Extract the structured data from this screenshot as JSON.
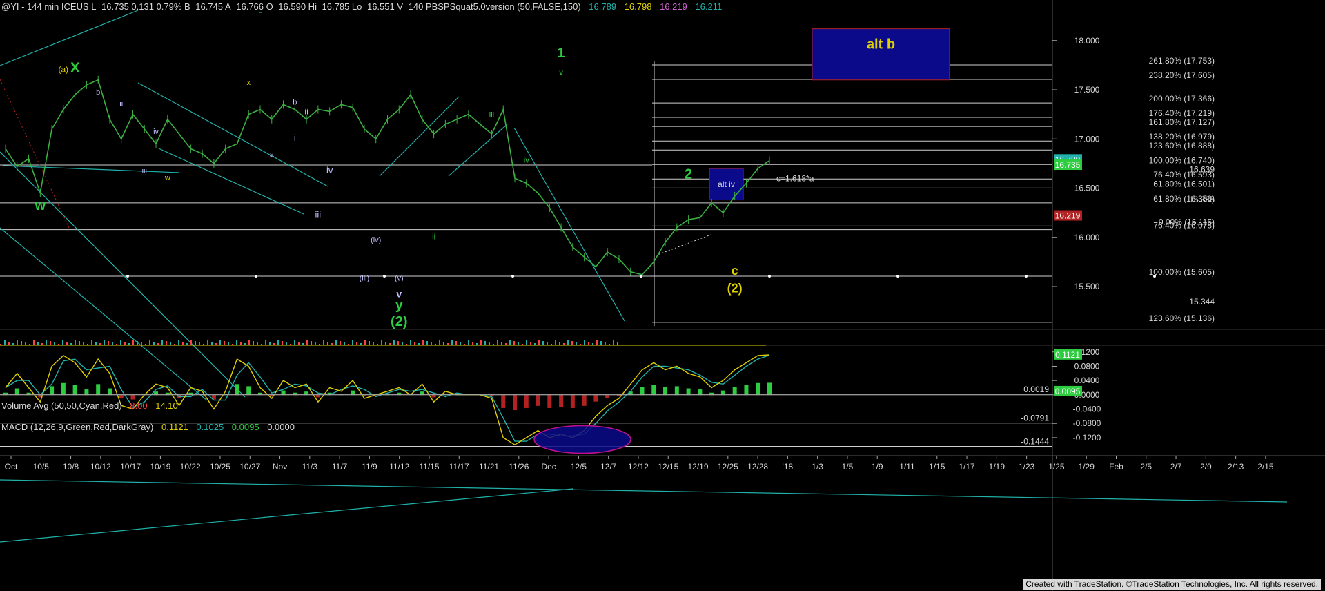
{
  "header": {
    "symbol_line": "@YI - 144 min  ICEUS  L=16.735  0.131  0.79%  B=16.745  A=16.766  O=16.590  Hi=16.785  Lo=16.551  V=140  PBSPSquat5.0version (50,FALSE,150)",
    "ind1": "16.789",
    "ind2": "16.798",
    "ind3": "16.219",
    "ind4": "16.211",
    "volume_label": "Volume Avg (50,50,Cyan,Red)",
    "volume_v1": "8.00",
    "volume_v2": "14.10",
    "macd_label": "MACD (12,26,9,Green,Red,DarkGray)",
    "macd_v1": "0.1121",
    "macd_v2": "0.1025",
    "macd_v3": "0.0095",
    "macd_v4": "0.0000"
  },
  "footer": "Created with TradeStation. ©TradeStation Technologies, Inc. All rights reserved.",
  "colors": {
    "bg": "#000000",
    "price": "#3cb043",
    "cyan": "#20b2aa",
    "white": "#d8d8d8",
    "yellow": "#e0d000",
    "green": "#2ecc40",
    "blue_box": "#0a0a8a",
    "red": "#b22222"
  },
  "chart_data": {
    "type": "line",
    "title": "@YI - 144 min",
    "price_axis": {
      "ticks": [
        "18.000",
        "17.500",
        "17.000",
        "16.500",
        "16.000",
        "15.500"
      ],
      "ylim": [
        15.1,
        18.3
      ]
    },
    "macd_axis": {
      "ticks": [
        "0.1200",
        "0.0800",
        "0.0400",
        "0.0000",
        "-0.0400",
        "-0.0800",
        "-0.1200"
      ],
      "ylim": [
        -0.155,
        0.135
      ]
    },
    "x_labels": [
      "Oct",
      "10/5",
      "10/8",
      "10/12",
      "10/17",
      "10/19",
      "10/22",
      "10/25",
      "10/27",
      "Nov",
      "11/3",
      "11/7",
      "11/9",
      "11/12",
      "11/15",
      "11/17",
      "11/21",
      "11/26",
      "Dec",
      "12/5",
      "12/7",
      "12/12",
      "12/15",
      "12/19",
      "12/25",
      "12/28",
      "'18",
      "1/3",
      "1/5",
      "1/9",
      "1/11",
      "1/15",
      "1/17",
      "1/19",
      "1/23",
      "1/25",
      "1/29",
      "Feb",
      "2/5",
      "2/7",
      "2/9",
      "2/13",
      "2/15"
    ],
    "price_series": [
      16.9,
      16.72,
      16.8,
      16.45,
      17.1,
      17.3,
      17.45,
      17.55,
      17.6,
      17.2,
      17.0,
      17.25,
      17.1,
      16.95,
      17.2,
      17.05,
      16.9,
      16.85,
      16.75,
      16.9,
      16.95,
      17.25,
      17.3,
      17.2,
      17.35,
      17.3,
      17.2,
      17.3,
      17.28,
      17.35,
      17.32,
      17.1,
      17.0,
      17.2,
      17.3,
      17.45,
      17.2,
      17.05,
      17.15,
      17.2,
      17.25,
      17.15,
      17.05,
      17.3,
      16.6,
      16.55,
      16.45,
      16.3,
      16.1,
      15.9,
      15.8,
      15.7,
      15.85,
      15.78,
      15.65,
      15.62,
      15.75,
      15.95,
      16.1,
      16.18,
      16.2,
      16.35,
      16.25,
      16.42,
      16.55,
      16.7,
      16.78
    ],
    "macd_series": [
      0.02,
      0.06,
      0.02,
      -0.02,
      0.08,
      0.11,
      0.09,
      0.05,
      0.1,
      0.06,
      -0.03,
      -0.04,
      0.0,
      0.03,
      0.02,
      -0.03,
      0.02,
      0.01,
      -0.04,
      0.01,
      0.1,
      0.08,
      0.02,
      -0.01,
      0.04,
      0.02,
      0.03,
      -0.02,
      0.02,
      0.01,
      0.04,
      -0.01,
      0.0,
      0.01,
      0.02,
      0.0,
      0.03,
      -0.02,
      0.01,
      0.0,
      0.0,
      0.0,
      -0.01,
      -0.12,
      -0.14,
      -0.12,
      -0.1,
      -0.12,
      -0.11,
      -0.12,
      -0.1,
      -0.06,
      -0.03,
      -0.01,
      0.03,
      0.07,
      0.09,
      0.07,
      0.08,
      0.06,
      0.05,
      0.02,
      0.04,
      0.07,
      0.09,
      0.11,
      0.112
    ],
    "fib_labels": [
      {
        "text": "261.80% (17.753)",
        "value": 17.753
      },
      {
        "text": "238.20% (17.605)",
        "value": 17.605
      },
      {
        "text": "200.00% (17.366)",
        "value": 17.366
      },
      {
        "text": "176.40% (17.219)",
        "value": 17.219
      },
      {
        "text": "161.80% (17.127)",
        "value": 17.127
      },
      {
        "text": "138.20% (16.979)",
        "value": 16.979
      },
      {
        "text": "123.60% (16.888)",
        "value": 16.888
      },
      {
        "text": "100.00% (16.740)",
        "value": 16.74
      },
      {
        "text": "76.40% (16.593)",
        "value": 16.593
      },
      {
        "text": "61.80% (16.501)",
        "value": 16.501
      },
      {
        "text": "61.80% (16.350)",
        "value": 16.35
      },
      {
        "text": "0.00% (16.115)",
        "value": 16.115
      },
      {
        "text": "76.40% (16.078)",
        "value": 16.078
      },
      {
        "text": "100.00% (15.605)",
        "value": 15.605
      },
      {
        "text": "123.60% (15.136)",
        "value": 15.136
      }
    ],
    "price_flags": [
      {
        "text": "16.789",
        "value": 16.789,
        "color": "#20b2aa"
      },
      {
        "text": "16.735",
        "value": 16.735,
        "color": "#2ecc40"
      },
      {
        "text": "16.219",
        "value": 16.219,
        "color": "#b22222"
      }
    ],
    "misc_levels": [
      {
        "text": "16.385",
        "value": 16.385
      },
      {
        "text": "15.344",
        "value": 15.344
      },
      {
        "text": "16.639",
        "value": 16.69
      },
      {
        "text": "c=1.618*a",
        "value": 16.6
      }
    ],
    "macd_flags": [
      {
        "text": "0.1121",
        "value": 0.1121,
        "color": "#2ecc40"
      },
      {
        "text": "0.0095",
        "value": 0.0095,
        "color": "#2ecc40"
      }
    ],
    "macd_levels": [
      {
        "text": "0.0019",
        "value": 0.0019
      },
      {
        "text": "-0.0791",
        "value": -0.0791
      },
      {
        "text": "-0.1444",
        "value": -0.1444
      }
    ],
    "wave_labels": [
      {
        "text": "(a)",
        "x": 5,
        "y": 17.68,
        "color": "#e0d000",
        "size": 12
      },
      {
        "text": "X",
        "x": 6,
        "y": 17.68,
        "color": "#2ecc40",
        "size": 20
      },
      {
        "text": "w",
        "x": 3,
        "y": 16.28,
        "color": "#2ecc40",
        "size": 20
      },
      {
        "text": "b",
        "x": 8,
        "y": 17.45,
        "color": "#c0c0ff",
        "size": 11
      },
      {
        "text": "ii",
        "x": 10,
        "y": 17.33,
        "color": "#c0c0ff",
        "size": 11
      },
      {
        "text": "iv",
        "x": 13,
        "y": 17.05,
        "color": "#c0c0ff",
        "size": 11
      },
      {
        "text": "iii",
        "x": 12,
        "y": 16.65,
        "color": "#c0c0ff",
        "size": 11
      },
      {
        "text": "w",
        "x": 14,
        "y": 16.58,
        "color": "#e0d000",
        "size": 11
      },
      {
        "text": "x",
        "x": 21,
        "y": 17.55,
        "color": "#e0d000",
        "size": 11
      },
      {
        "text": "a",
        "x": 23,
        "y": 16.82,
        "color": "#c0c0ff",
        "size": 11
      },
      {
        "text": "b",
        "x": 25,
        "y": 17.35,
        "color": "#c0c0ff",
        "size": 11
      },
      {
        "text": "ii",
        "x": 26,
        "y": 17.25,
        "color": "#c0c0ff",
        "size": 13
      },
      {
        "text": "i",
        "x": 25,
        "y": 16.98,
        "color": "#c0c0ff",
        "size": 13
      },
      {
        "text": "iv",
        "x": 28,
        "y": 16.65,
        "color": "#c0c0ff",
        "size": 13
      },
      {
        "text": "iii",
        "x": 27,
        "y": 16.2,
        "color": "#c0c0ff",
        "size": 13
      },
      {
        "text": "(iv)",
        "x": 32,
        "y": 15.95,
        "color": "#c0c0ff",
        "size": 11
      },
      {
        "text": "(iii)",
        "x": 31,
        "y": 15.56,
        "color": "#c0c0ff",
        "size": 11
      },
      {
        "text": "(v)",
        "x": 34,
        "y": 15.56,
        "color": "#c0c0ff",
        "size": 11
      },
      {
        "text": "v",
        "x": 34,
        "y": 15.39,
        "color": "#c0c0ff",
        "size": 14
      },
      {
        "text": "y",
        "x": 34,
        "y": 15.27,
        "color": "#2ecc40",
        "size": 20
      },
      {
        "text": "(2)",
        "x": 34,
        "y": 15.1,
        "color": "#2ecc40",
        "size": 20
      },
      {
        "text": "ii",
        "x": 37,
        "y": 15.98,
        "color": "#2ecc40",
        "size": 11
      },
      {
        "text": "iii",
        "x": 42,
        "y": 17.22,
        "color": "#2ecc40",
        "size": 11
      },
      {
        "text": "iv",
        "x": 45,
        "y": 16.76,
        "color": "#2ecc40",
        "size": 11
      },
      {
        "text": "1",
        "x": 48,
        "y": 17.83,
        "color": "#2ecc40",
        "size": 20
      },
      {
        "text": "v",
        "x": 48,
        "y": 17.65,
        "color": "#2ecc40",
        "size": 11
      },
      {
        "text": "2",
        "x": 59,
        "y": 16.6,
        "color": "#2ecc40",
        "size": 20
      },
      {
        "text": "c",
        "x": 63,
        "y": 15.62,
        "color": "#e0d000",
        "size": 18
      },
      {
        "text": "(2)",
        "x": 63,
        "y": 15.44,
        "color": "#e0d000",
        "size": 18
      }
    ],
    "boxes": [
      {
        "text": "alt b",
        "x0": 43,
        "x1": 50,
        "y0": 18.12,
        "y1": 17.6
      },
      {
        "text": "alt iv",
        "x0": 37,
        "x1": 39,
        "y0": 16.7,
        "y1": 16.38
      }
    ]
  }
}
